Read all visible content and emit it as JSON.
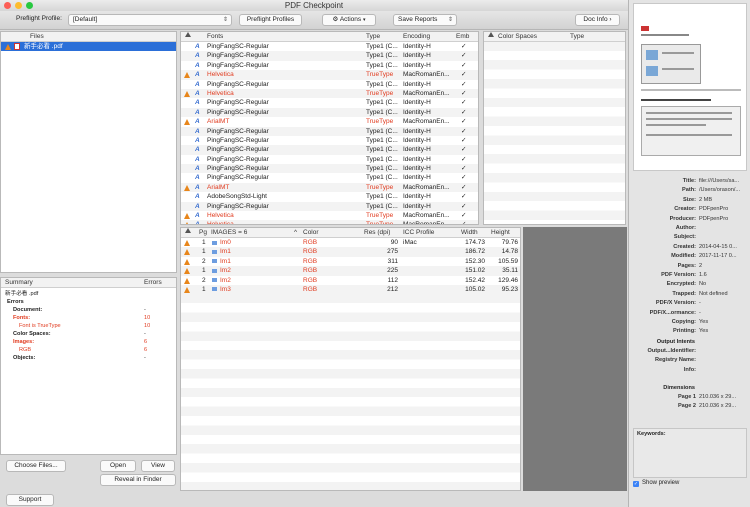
{
  "window": {
    "title": "PDF Checkpoint"
  },
  "toolbar": {
    "profile_label": "Preflight Profile:",
    "profile_value": "[Default]",
    "preflight_profiles": "Preflight Profiles",
    "actions": "Actions",
    "save_reports": "Save Reports",
    "doc_info": "Doc Info"
  },
  "files": {
    "header": "Files",
    "items": [
      {
        "name": "新手必看 .pdf"
      }
    ]
  },
  "fonts": {
    "headers": {
      "fonts": "Fonts",
      "type": "Type",
      "encoding": "Encoding",
      "emb": "Emb"
    },
    "rows": [
      {
        "warn": false,
        "name": "PingFangSC-Regular",
        "type": "Type1 (C...",
        "encoding": "Identity-H",
        "emb": "✓"
      },
      {
        "warn": false,
        "name": "PingFangSC-Regular",
        "type": "Type1 (C...",
        "encoding": "Identity-H",
        "emb": "✓"
      },
      {
        "warn": false,
        "name": "PingFangSC-Regular",
        "type": "Type1 (C...",
        "encoding": "Identity-H",
        "emb": "✓"
      },
      {
        "warn": true,
        "name": "Helvetica",
        "type": "TrueType",
        "encoding": "MacRomanEn...",
        "emb": "✓"
      },
      {
        "warn": false,
        "name": "PingFangSC-Regular",
        "type": "Type1 (C...",
        "encoding": "Identity-H",
        "emb": "✓"
      },
      {
        "warn": true,
        "name": "Helvetica",
        "type": "TrueType",
        "encoding": "MacRomanEn...",
        "emb": "✓"
      },
      {
        "warn": false,
        "name": "PingFangSC-Regular",
        "type": "Type1 (C...",
        "encoding": "Identity-H",
        "emb": "✓"
      },
      {
        "warn": false,
        "name": "PingFangSC-Regular",
        "type": "Type1 (C...",
        "encoding": "Identity-H",
        "emb": "✓"
      },
      {
        "warn": true,
        "name": "ArialMT",
        "type": "TrueType",
        "encoding": "MacRomanEn...",
        "emb": "✓"
      },
      {
        "warn": false,
        "name": "PingFangSC-Regular",
        "type": "Type1 (C...",
        "encoding": "Identity-H",
        "emb": "✓"
      },
      {
        "warn": false,
        "name": "PingFangSC-Regular",
        "type": "Type1 (C...",
        "encoding": "Identity-H",
        "emb": "✓"
      },
      {
        "warn": false,
        "name": "PingFangSC-Regular",
        "type": "Type1 (C...",
        "encoding": "Identity-H",
        "emb": "✓"
      },
      {
        "warn": false,
        "name": "PingFangSC-Regular",
        "type": "Type1 (C...",
        "encoding": "Identity-H",
        "emb": "✓"
      },
      {
        "warn": false,
        "name": "PingFangSC-Regular",
        "type": "Type1 (C...",
        "encoding": "Identity-H",
        "emb": "✓"
      },
      {
        "warn": false,
        "name": "PingFangSC-Regular",
        "type": "Type1 (C...",
        "encoding": "Identity-H",
        "emb": "✓"
      },
      {
        "warn": true,
        "name": "ArialMT",
        "type": "TrueType",
        "encoding": "MacRomanEn...",
        "emb": "✓"
      },
      {
        "warn": false,
        "name": "AdobeSongStd-Light",
        "type": "Type1 (C...",
        "encoding": "Identity-H",
        "emb": "✓"
      },
      {
        "warn": false,
        "name": "PingFangSC-Regular",
        "type": "Type1 (C...",
        "encoding": "Identity-H",
        "emb": "✓"
      },
      {
        "warn": true,
        "name": "Helvetica",
        "type": "TrueType",
        "encoding": "MacRomanEn...",
        "emb": "✓"
      },
      {
        "warn": true,
        "name": "Helvetica",
        "type": "TrueType",
        "encoding": "MacRomanEn...",
        "emb": "✓"
      }
    ]
  },
  "colorspaces": {
    "headers": {
      "name": "Color Spaces",
      "type": "Type"
    }
  },
  "images": {
    "headers": {
      "pg": "Pg",
      "images": "IMAGES = 6",
      "color": "Color",
      "res": "Res (dpi)",
      "icc": "ICC Profile",
      "width": "Width",
      "height": "Height"
    },
    "rows": [
      {
        "pg": "1",
        "name": "Im0",
        "color": "RGB",
        "res": "90",
        "icc": "iMac",
        "width": "174.73",
        "height": "79.76"
      },
      {
        "pg": "1",
        "name": "Im1",
        "color": "RGB",
        "res": "275",
        "icc": "",
        "width": "186.72",
        "height": "14.78"
      },
      {
        "pg": "2",
        "name": "Im1",
        "color": "RGB",
        "res": "311",
        "icc": "",
        "width": "152.30",
        "height": "105.59"
      },
      {
        "pg": "1",
        "name": "Im2",
        "color": "RGB",
        "res": "225",
        "icc": "",
        "width": "151.02",
        "height": "35.11"
      },
      {
        "pg": "2",
        "name": "Im2",
        "color": "RGB",
        "res": "112",
        "icc": "",
        "width": "152.42",
        "height": "129.46"
      },
      {
        "pg": "1",
        "name": "Im3",
        "color": "RGB",
        "res": "212",
        "icc": "",
        "width": "105.02",
        "height": "95.23"
      }
    ]
  },
  "summary": {
    "headers": {
      "summary": "Summary",
      "errors": "Errors"
    },
    "file": "新手必看 .pdf",
    "rows": [
      {
        "label": "Errors",
        "value": "",
        "indent": 0,
        "red": false
      },
      {
        "label": "Document:",
        "value": "-",
        "indent": 1,
        "red": false
      },
      {
        "label": "Fonts:",
        "value": "10",
        "indent": 1,
        "red": true
      },
      {
        "label": "Font is TrueType",
        "value": "10",
        "indent": 2,
        "red": true
      },
      {
        "label": "Color Spaces:",
        "value": "-",
        "indent": 1,
        "red": false
      },
      {
        "label": "Images:",
        "value": "6",
        "indent": 1,
        "red": true
      },
      {
        "label": "RGB",
        "value": "6",
        "indent": 2,
        "red": true
      },
      {
        "label": "Objects:",
        "value": "-",
        "indent": 1,
        "red": false
      }
    ]
  },
  "buttons": {
    "choose_files": "Choose Files...",
    "open": "Open",
    "view": "View",
    "reveal": "Reveal in Finder",
    "support": "Support"
  },
  "docinfo": {
    "rows": [
      {
        "k": "Title:",
        "v": "file:///Users/sa..."
      },
      {
        "k": "Path:",
        "v": "/Users/orason/..."
      },
      {
        "k": "Size:",
        "v": "2 MB"
      },
      {
        "k": "Creator:",
        "v": "PDFpenPro"
      },
      {
        "k": "Producer:",
        "v": "PDFpenPro"
      },
      {
        "k": "Author:",
        "v": ""
      },
      {
        "k": "Subject:",
        "v": ""
      },
      {
        "k": "Created:",
        "v": "2014-04-15 0..."
      },
      {
        "k": "Modified:",
        "v": "2017-11-17 0..."
      },
      {
        "k": "Pages:",
        "v": "2"
      },
      {
        "k": "PDF Version:",
        "v": "1.6"
      },
      {
        "k": "Encrypted:",
        "v": "No"
      },
      {
        "k": "Trapped:",
        "v": "Not defined"
      },
      {
        "k": "PDF/X Version:",
        "v": "-"
      },
      {
        "k": "PDF/X...ormance:",
        "v": "-"
      },
      {
        "k": "Copying:",
        "v": "Yes"
      },
      {
        "k": "Printing:",
        "v": "Yes"
      }
    ],
    "output_intents": "Output Intents",
    "intent_rows": [
      {
        "k": "Output...Identifier:",
        "v": ""
      },
      {
        "k": "Registry Name:",
        "v": ""
      },
      {
        "k": "Info:",
        "v": ""
      }
    ],
    "dimensions": "Dimensions",
    "dim_rows": [
      {
        "k": "Page 1",
        "v": "210.036 x 29..."
      },
      {
        "k": "Page 2",
        "v": "210.036 x 29..."
      }
    ],
    "keywords_label": "Keywords:",
    "show_preview": "Show preview"
  }
}
